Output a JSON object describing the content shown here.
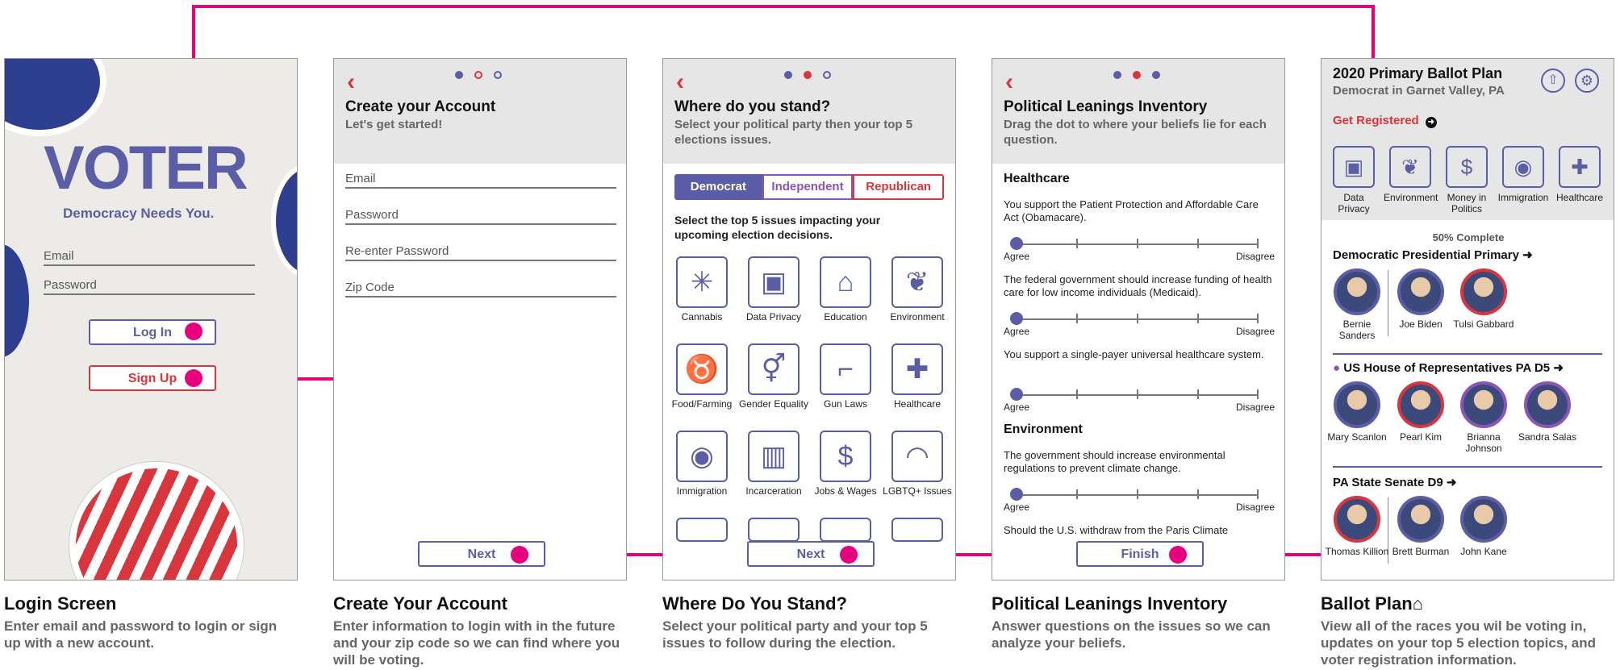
{
  "login": {
    "logo": "VOTER",
    "tagline": "Democracy Needs You.",
    "email": "Email",
    "password": "Password",
    "login_btn": "Log In",
    "signup_btn": "Sign Up"
  },
  "account": {
    "title": "Create your Account",
    "subtitle": "Let's get started!",
    "fields": [
      "Email",
      "Password",
      "Re-enter Password",
      "Zip Code"
    ],
    "next": "Next"
  },
  "stand": {
    "title": "Where do you stand?",
    "subtitle": "Select your political party then your top 5 elections issues.",
    "parties": [
      "Democrat",
      "Independent",
      "Republican"
    ],
    "instruction": "Select the top 5 issues impacting your upcoming election decisions.",
    "issues": [
      "Cannabis",
      "Data Privacy",
      "Education",
      "Environment",
      "Food/Farming",
      "Gender Equality",
      "Gun Laws",
      "Healthcare",
      "Immigration",
      "Incarceration",
      "Jobs & Wages",
      "LGBTQ+ Issues"
    ],
    "next": "Next"
  },
  "inventory": {
    "title": "Political Leanings Inventory",
    "subtitle": "Drag the dot to where your beliefs lie for each question.",
    "sections": [
      {
        "name": "Healthcare",
        "questions": [
          "You support the Patient Protection and Affordable Care Act (Obamacare).",
          "The federal government should increase funding of health care for low income individuals (Medicaid).",
          "You support a single-payer universal healthcare system."
        ]
      },
      {
        "name": "Environment",
        "questions": [
          "The government should increase environmental regulations to prevent climate change.",
          "Should the U.S. withdraw from the Paris Climate"
        ]
      }
    ],
    "agree": "Agree",
    "disagree": "Disagree",
    "finish": "Finish"
  },
  "ballot": {
    "title": "2020 Primary Ballot Plan",
    "subtitle": "Democrat in Garnet Valley, PA",
    "register": "Get Registered",
    "topics": [
      "Data Privacy",
      "Environment",
      "Money in Politics",
      "Immigration",
      "Healthcare"
    ],
    "progress": "50% Complete",
    "races": [
      {
        "name": "Democratic Presidential Primary",
        "candidates": [
          "Bernie Sanders",
          "Joe Biden",
          "Tulsi Gabbard"
        ]
      },
      {
        "name": "US House of Representatives PA D5",
        "candidates": [
          "Mary Scanlon",
          "Pearl Kim",
          "Brianna Johnson",
          "Sandra Salas"
        ]
      },
      {
        "name": "PA State Senate D9",
        "candidates": [
          "Thomas Killion",
          "Brett Burman",
          "John Kane"
        ]
      }
    ]
  },
  "captions": [
    {
      "title": "Login Screen",
      "desc": "Enter email and password to login or sign up with a new account."
    },
    {
      "title": "Create Your Account",
      "desc": "Enter information to login with in the future and your zip code so we can find where you will be voting."
    },
    {
      "title": "Where Do You Stand?",
      "desc": "Select your political party and your top 5 issues to follow during the election."
    },
    {
      "title": "Political Leanings Inventory",
      "desc": "Answer questions on the issues so we can analyze your beliefs."
    },
    {
      "title": "Ballot Plan",
      "desc": "View all of the races you wil be voting in, updates on your top 5 election topics, and voter registration information."
    }
  ],
  "colors": {
    "accent": "#e6007e",
    "blue": "#5b5ea6",
    "red": "#d8363c"
  }
}
